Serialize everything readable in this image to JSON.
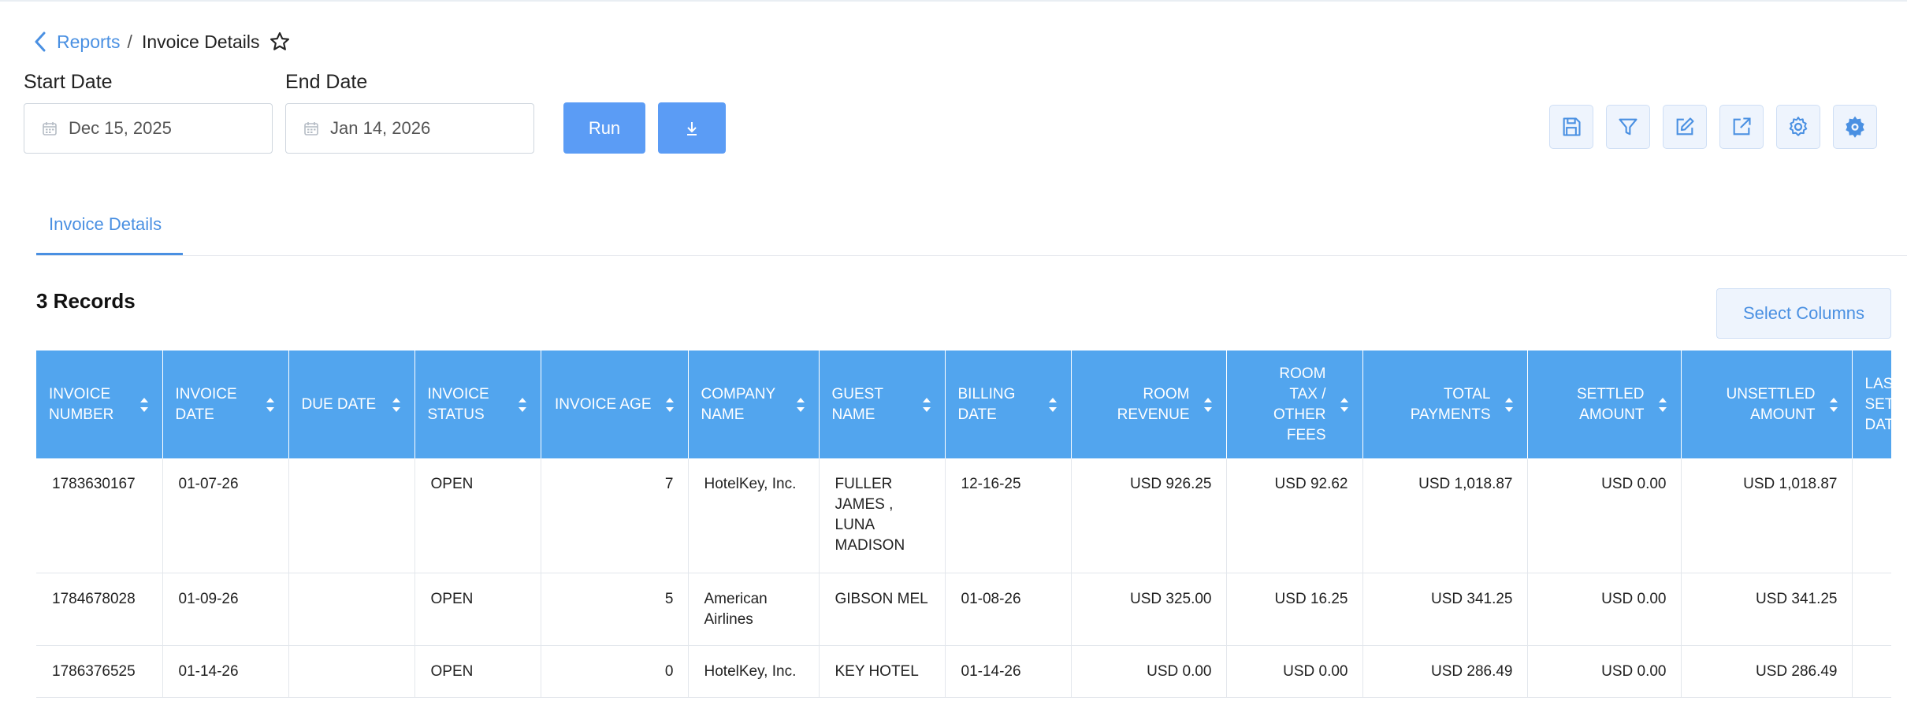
{
  "breadcrumb": {
    "parent": "Reports",
    "separator": "/",
    "current": "Invoice Details"
  },
  "filters": {
    "start_label": "Start Date",
    "start_value": "Dec 15, 2025",
    "end_label": "End Date",
    "end_value": "Jan 14, 2026",
    "run_label": "Run"
  },
  "toolbar_icons": [
    "save-icon",
    "filter-icon",
    "edit-icon",
    "export-icon",
    "settings-icon",
    "gear-settings-icon"
  ],
  "tab": {
    "label": "Invoice Details"
  },
  "records": {
    "label": "3 Records"
  },
  "select_columns_label": "Select Columns",
  "table": {
    "columns": [
      "Invoice Number",
      "Invoice Date",
      "Due Date",
      "Invoice Status",
      "Invoice Age",
      "Company Name",
      "Guest Name",
      "Billing Date",
      "Room Revenue",
      "Room Tax / Other Fees",
      "Total Payments",
      "Settled Amount",
      "Unsettled Amount",
      "Last Settled Date"
    ],
    "rows": [
      [
        "1783630167",
        "01-07-26",
        "",
        "OPEN",
        "7",
        "HotelKey, Inc.",
        "FULLER JAMES , LUNA MADISON",
        "12-16-25",
        "USD 926.25",
        "USD 92.62",
        "USD 1,018.87",
        "USD 0.00",
        "USD 1,018.87",
        ""
      ],
      [
        "1784678028",
        "01-09-26",
        "",
        "OPEN",
        "5",
        "American Airlines",
        "GIBSON MEL",
        "01-08-26",
        "USD 325.00",
        "USD 16.25",
        "USD 341.25",
        "USD 0.00",
        "USD 341.25",
        ""
      ],
      [
        "1786376525",
        "01-14-26",
        "",
        "OPEN",
        "0",
        "HotelKey, Inc.",
        "KEY HOTEL",
        "01-14-26",
        "USD 0.00",
        "USD 0.00",
        "USD 286.49",
        "USD 0.00",
        "USD 286.49",
        ""
      ]
    ]
  },
  "colors": {
    "accent": "#4a90e2",
    "header_bg": "#52a5ee",
    "button_bg": "#5b9cf5"
  }
}
